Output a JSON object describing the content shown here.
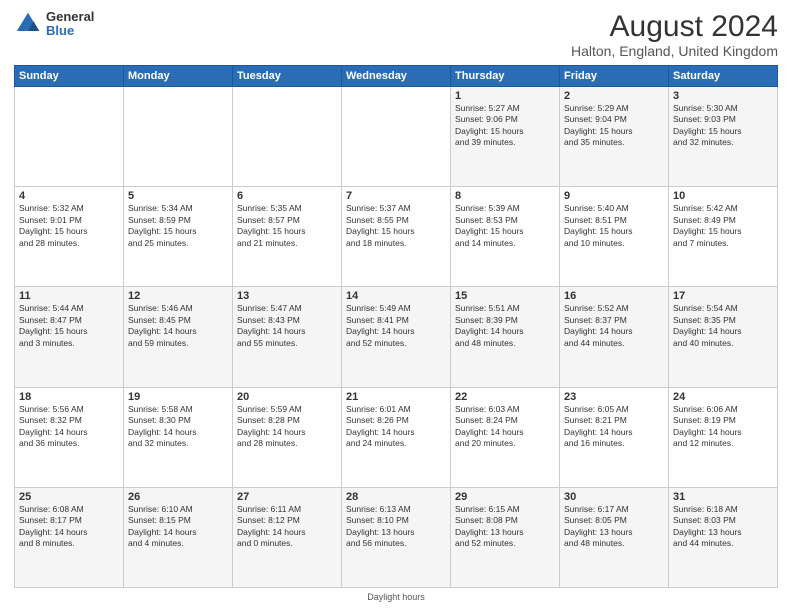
{
  "logo": {
    "general": "General",
    "blue": "Blue"
  },
  "header": {
    "title": "August 2024",
    "subtitle": "Halton, England, United Kingdom"
  },
  "weekdays": [
    "Sunday",
    "Monday",
    "Tuesday",
    "Wednesday",
    "Thursday",
    "Friday",
    "Saturday"
  ],
  "footer": {
    "note": "Daylight hours"
  },
  "weeks": [
    [
      {
        "day": "",
        "info": ""
      },
      {
        "day": "",
        "info": ""
      },
      {
        "day": "",
        "info": ""
      },
      {
        "day": "",
        "info": ""
      },
      {
        "day": "1",
        "info": "Sunrise: 5:27 AM\nSunset: 9:06 PM\nDaylight: 15 hours\nand 39 minutes."
      },
      {
        "day": "2",
        "info": "Sunrise: 5:29 AM\nSunset: 9:04 PM\nDaylight: 15 hours\nand 35 minutes."
      },
      {
        "day": "3",
        "info": "Sunrise: 5:30 AM\nSunset: 9:03 PM\nDaylight: 15 hours\nand 32 minutes."
      }
    ],
    [
      {
        "day": "4",
        "info": "Sunrise: 5:32 AM\nSunset: 9:01 PM\nDaylight: 15 hours\nand 28 minutes."
      },
      {
        "day": "5",
        "info": "Sunrise: 5:34 AM\nSunset: 8:59 PM\nDaylight: 15 hours\nand 25 minutes."
      },
      {
        "day": "6",
        "info": "Sunrise: 5:35 AM\nSunset: 8:57 PM\nDaylight: 15 hours\nand 21 minutes."
      },
      {
        "day": "7",
        "info": "Sunrise: 5:37 AM\nSunset: 8:55 PM\nDaylight: 15 hours\nand 18 minutes."
      },
      {
        "day": "8",
        "info": "Sunrise: 5:39 AM\nSunset: 8:53 PM\nDaylight: 15 hours\nand 14 minutes."
      },
      {
        "day": "9",
        "info": "Sunrise: 5:40 AM\nSunset: 8:51 PM\nDaylight: 15 hours\nand 10 minutes."
      },
      {
        "day": "10",
        "info": "Sunrise: 5:42 AM\nSunset: 8:49 PM\nDaylight: 15 hours\nand 7 minutes."
      }
    ],
    [
      {
        "day": "11",
        "info": "Sunrise: 5:44 AM\nSunset: 8:47 PM\nDaylight: 15 hours\nand 3 minutes."
      },
      {
        "day": "12",
        "info": "Sunrise: 5:46 AM\nSunset: 8:45 PM\nDaylight: 14 hours\nand 59 minutes."
      },
      {
        "day": "13",
        "info": "Sunrise: 5:47 AM\nSunset: 8:43 PM\nDaylight: 14 hours\nand 55 minutes."
      },
      {
        "day": "14",
        "info": "Sunrise: 5:49 AM\nSunset: 8:41 PM\nDaylight: 14 hours\nand 52 minutes."
      },
      {
        "day": "15",
        "info": "Sunrise: 5:51 AM\nSunset: 8:39 PM\nDaylight: 14 hours\nand 48 minutes."
      },
      {
        "day": "16",
        "info": "Sunrise: 5:52 AM\nSunset: 8:37 PM\nDaylight: 14 hours\nand 44 minutes."
      },
      {
        "day": "17",
        "info": "Sunrise: 5:54 AM\nSunset: 8:35 PM\nDaylight: 14 hours\nand 40 minutes."
      }
    ],
    [
      {
        "day": "18",
        "info": "Sunrise: 5:56 AM\nSunset: 8:32 PM\nDaylight: 14 hours\nand 36 minutes."
      },
      {
        "day": "19",
        "info": "Sunrise: 5:58 AM\nSunset: 8:30 PM\nDaylight: 14 hours\nand 32 minutes."
      },
      {
        "day": "20",
        "info": "Sunrise: 5:59 AM\nSunset: 8:28 PM\nDaylight: 14 hours\nand 28 minutes."
      },
      {
        "day": "21",
        "info": "Sunrise: 6:01 AM\nSunset: 8:26 PM\nDaylight: 14 hours\nand 24 minutes."
      },
      {
        "day": "22",
        "info": "Sunrise: 6:03 AM\nSunset: 8:24 PM\nDaylight: 14 hours\nand 20 minutes."
      },
      {
        "day": "23",
        "info": "Sunrise: 6:05 AM\nSunset: 8:21 PM\nDaylight: 14 hours\nand 16 minutes."
      },
      {
        "day": "24",
        "info": "Sunrise: 6:06 AM\nSunset: 8:19 PM\nDaylight: 14 hours\nand 12 minutes."
      }
    ],
    [
      {
        "day": "25",
        "info": "Sunrise: 6:08 AM\nSunset: 8:17 PM\nDaylight: 14 hours\nand 8 minutes."
      },
      {
        "day": "26",
        "info": "Sunrise: 6:10 AM\nSunset: 8:15 PM\nDaylight: 14 hours\nand 4 minutes."
      },
      {
        "day": "27",
        "info": "Sunrise: 6:11 AM\nSunset: 8:12 PM\nDaylight: 14 hours\nand 0 minutes."
      },
      {
        "day": "28",
        "info": "Sunrise: 6:13 AM\nSunset: 8:10 PM\nDaylight: 13 hours\nand 56 minutes."
      },
      {
        "day": "29",
        "info": "Sunrise: 6:15 AM\nSunset: 8:08 PM\nDaylight: 13 hours\nand 52 minutes."
      },
      {
        "day": "30",
        "info": "Sunrise: 6:17 AM\nSunset: 8:05 PM\nDaylight: 13 hours\nand 48 minutes."
      },
      {
        "day": "31",
        "info": "Sunrise: 6:18 AM\nSunset: 8:03 PM\nDaylight: 13 hours\nand 44 minutes."
      }
    ]
  ]
}
